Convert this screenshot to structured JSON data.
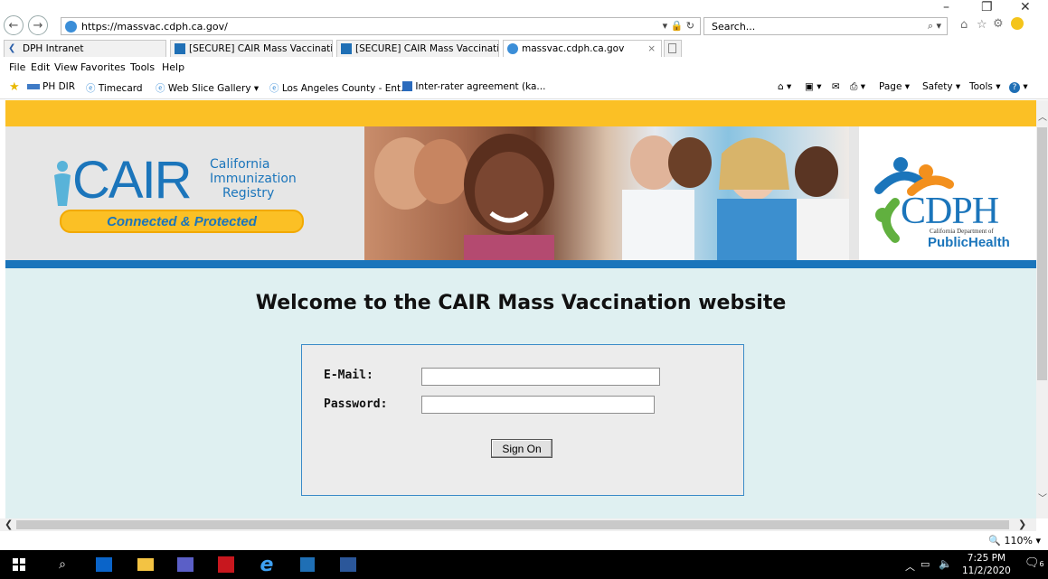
{
  "browser": {
    "url": "https://massvac.cdph.ca.gov/",
    "search_placeholder": "Search...",
    "tabs": [
      {
        "label": "DPH Intranet"
      },
      {
        "label": "[SECURE] CAIR Mass Vaccinati..."
      },
      {
        "label": "[SECURE] CAIR Mass Vaccinati..."
      },
      {
        "label": "massvac.cdph.ca.gov"
      }
    ],
    "menu": [
      "File",
      "Edit",
      "View",
      "Favorites",
      "Tools",
      "Help"
    ],
    "favorites": [
      "PH DIR",
      "Timecard",
      "Web Slice Gallery ▾",
      "Los Angeles County - Ent...",
      "Inter-rater agreement (ka..."
    ],
    "commands": [
      "Page ▾",
      "Safety ▾",
      "Tools ▾"
    ],
    "zoom": "110%"
  },
  "page": {
    "cair_logo": {
      "name": "CAIR",
      "line1": "California",
      "line2": "Immunization",
      "line3": "Registry",
      "tagline": "Connected & Protected"
    },
    "cdph_logo": {
      "name": "CDPH",
      "subtitle": "California Department of",
      "health": "PublicHealth"
    },
    "welcome": "Welcome to the CAIR Mass Vaccination website",
    "login": {
      "email_label": "E-Mail:",
      "password_label": "Password:",
      "email_value": "",
      "password_value": "",
      "signon_label": "Sign On"
    }
  },
  "taskbar": {
    "time": "7:25 PM",
    "date": "11/2/2020",
    "notif_count": "6"
  },
  "colors": {
    "gold": "#fbc025",
    "blue": "#1a75bb",
    "page_bg": "#dff0f1"
  }
}
